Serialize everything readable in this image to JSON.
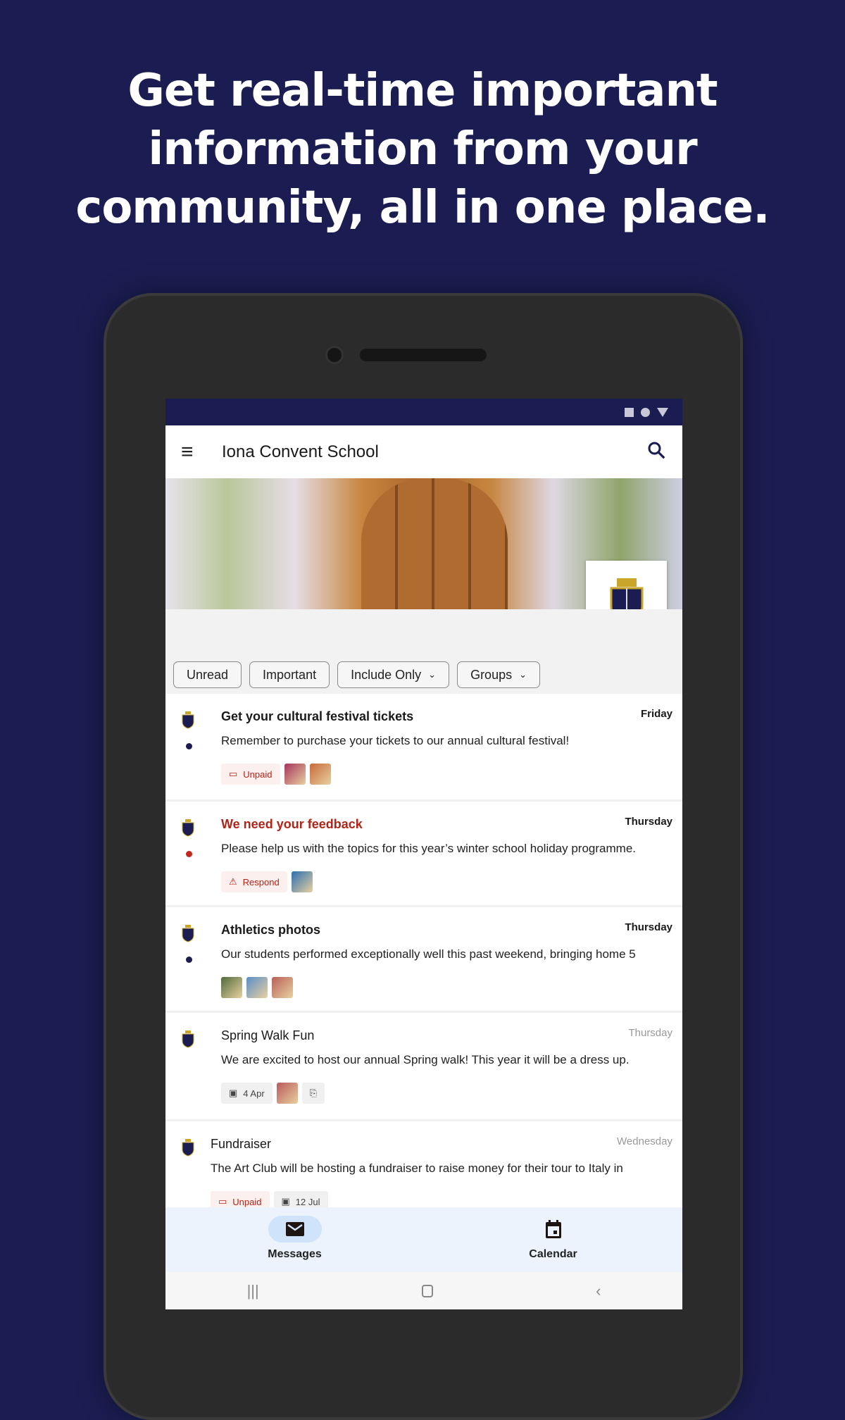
{
  "headline": [
    "Get real-time important",
    "information from your",
    "community, all in one place."
  ],
  "app": {
    "title": "Iona Convent School"
  },
  "filters": [
    {
      "label": "Unread"
    },
    {
      "label": "Important"
    },
    {
      "label": "Include Only",
      "dropdown": true
    },
    {
      "label": "Groups",
      "dropdown": true
    }
  ],
  "messages": [
    {
      "title": "Get your cultural festival tickets",
      "date": "Friday",
      "body": "Remember to purchase your tickets to our annual cultural festival!",
      "unread": true,
      "dot": "#1b1d52",
      "tags": [
        {
          "type": "payment",
          "label": "Unpaid"
        }
      ],
      "thumbs": [
        "#a8345c",
        "#c86a3a"
      ]
    },
    {
      "title": "We need your feedback",
      "date": "Thursday",
      "body": "Please help us with the topics for this year’s winter school holiday programme.",
      "unread": true,
      "important": true,
      "dot": "#c0281c",
      "tags": [
        {
          "type": "feedback",
          "label": "Respond"
        }
      ],
      "thumbs": [
        "#2a6fb0"
      ]
    },
    {
      "title": "Athletics photos",
      "date": "Thursday",
      "body": "Our students performed exceptionally well this past weekend, bringing home 5",
      "unread": true,
      "dot": "#1b1d52",
      "tags": [],
      "thumbs": [
        "#4f6b3d",
        "#5a8fc8",
        "#b86058"
      ]
    },
    {
      "title": "Spring Walk Fun",
      "date": "Thursday",
      "body": "We are excited to host our annual Spring walk!  This year it will be a dress up.",
      "unread": false,
      "tags": [
        {
          "type": "event",
          "label": "4 Apr"
        }
      ],
      "thumbs": [
        "#b95a5a"
      ],
      "pdf": true
    },
    {
      "title": "Fundraiser",
      "date": "Wednesday",
      "body": "The Art Club will be hosting a fundraiser to raise money for their tour to Italy in",
      "unread": false,
      "tags": [
        {
          "type": "payment",
          "label": "Unpaid"
        },
        {
          "type": "event",
          "label": "12 Jul"
        }
      ],
      "thumbs": []
    }
  ],
  "bottom_nav": [
    {
      "label": "Messages",
      "icon": "mail-icon",
      "active": true
    },
    {
      "label": "Calendar",
      "icon": "calendar-icon"
    }
  ],
  "colors": {
    "brand": "#1b1d52",
    "important": "#b32418",
    "nav_active": "#cfe3fb"
  }
}
